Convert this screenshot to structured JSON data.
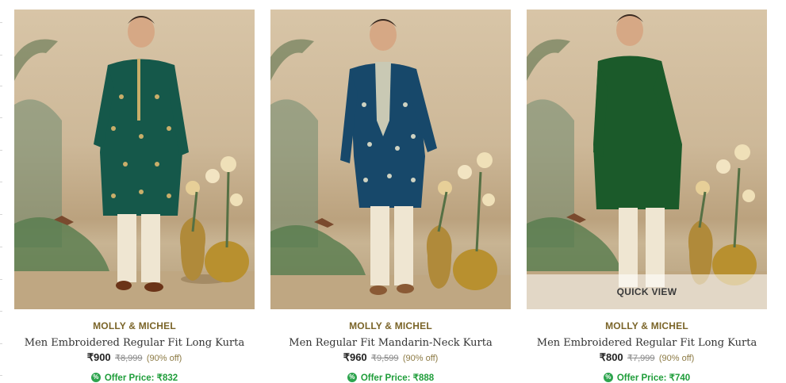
{
  "products": [
    {
      "brand": "MOLLY & MICHEL",
      "name": "Men Embroidered Regular Fit Long Kurta",
      "price": "₹900",
      "mrp": "₹8,999",
      "discount": "(90% off)",
      "offer": "Offer Price: ₹832",
      "kurta_color": "#15584a"
    },
    {
      "brand": "MOLLY & MICHEL",
      "name": "Men Regular Fit Mandarin-Neck Kurta",
      "price": "₹960",
      "mrp": "₹9,599",
      "discount": "(90% off)",
      "offer": "Offer Price: ₹888",
      "kurta_color": "#17486a"
    },
    {
      "brand": "MOLLY & MICHEL",
      "name": "Men Embroidered Regular Fit Long Kurta",
      "price": "₹800",
      "mrp": "₹7,999",
      "discount": "(90% off)",
      "offer": "Offer Price: ₹740",
      "kurta_color": "#1b5a2a",
      "quick_view": "QUICK VIEW"
    }
  ],
  "offer_icon": "%"
}
